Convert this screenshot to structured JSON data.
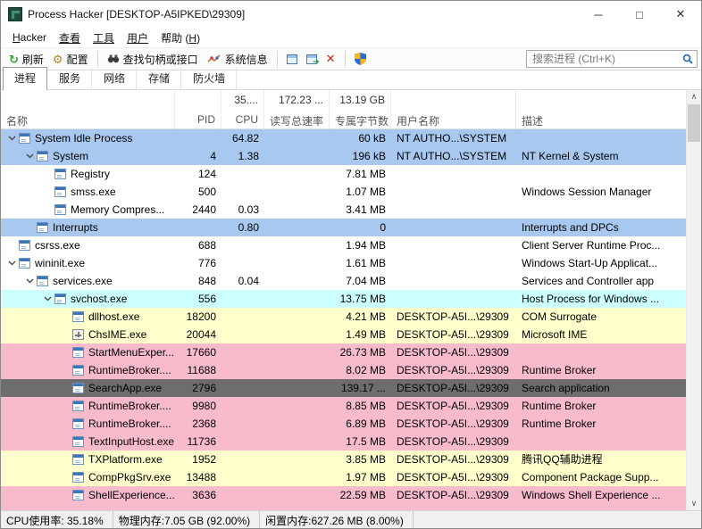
{
  "window": {
    "title": "Process Hacker [DESKTOP-A5IPKED\\29309]"
  },
  "window_controls": {
    "minimize": "─",
    "maximize": "□",
    "close": "✕"
  },
  "menu": {
    "hacker_accel": "H",
    "hacker_rest": "acker",
    "view": "查看",
    "tools": "工具",
    "users": "用户",
    "help_pre": "帮助 (",
    "help_accel": "H",
    "help_post": ")"
  },
  "toolbar": {
    "refresh": "刷新",
    "options": "配置",
    "find_handles": "查找句柄或接口",
    "system_info": "系统信息",
    "search_placeholder": "搜索进程 (Ctrl+K)"
  },
  "tabs": {
    "processes": "进程",
    "services": "服务",
    "network": "网络",
    "disk": "存储",
    "firewall": "防火墙"
  },
  "columns": {
    "name": "名称",
    "pid": "PID",
    "cpu": "CPU",
    "io": "读写总速率",
    "private": "专属字节数",
    "user": "用户名称",
    "desc": "描述",
    "totals": {
      "cpu": "35....",
      "io": "172.23 ...",
      "private": "13.19 GB"
    }
  },
  "colors": {
    "system": "#a9c8ef",
    "service": "#ccffff",
    "own": "#ffffcc",
    "immersive": "#f8bbcc",
    "suspended": "#6d6d6d",
    "none": ""
  },
  "rows": [
    {
      "name": "System Idle Process",
      "pid": "",
      "cpu": "64.82",
      "io": "",
      "priv": "60 kB",
      "user": "NT AUTHO...\\SYSTEM",
      "desc": "",
      "color": "system",
      "level": 0,
      "expanded": true
    },
    {
      "name": "System",
      "pid": "4",
      "cpu": "1.38",
      "io": "",
      "priv": "196 kB",
      "user": "NT AUTHO...\\SYSTEM",
      "desc": "NT Kernel & System",
      "color": "system",
      "level": 1,
      "expanded": true
    },
    {
      "name": "Registry",
      "pid": "124",
      "cpu": "",
      "io": "",
      "priv": "7.81 MB",
      "user": "",
      "desc": "",
      "color": "none",
      "level": 2,
      "expanded": false
    },
    {
      "name": "smss.exe",
      "pid": "500",
      "cpu": "",
      "io": "",
      "priv": "1.07 MB",
      "user": "",
      "desc": "Windows Session Manager",
      "color": "none",
      "level": 2,
      "expanded": false
    },
    {
      "name": "Memory Compres...",
      "pid": "2440",
      "cpu": "0.03",
      "io": "",
      "priv": "3.41 MB",
      "user": "",
      "desc": "",
      "color": "none",
      "level": 2,
      "expanded": false
    },
    {
      "name": "Interrupts",
      "pid": "",
      "cpu": "0.80",
      "io": "",
      "priv": "0",
      "user": "",
      "desc": "Interrupts and DPCs",
      "color": "system",
      "level": 1,
      "expanded": false
    },
    {
      "name": "csrss.exe",
      "pid": "688",
      "cpu": "",
      "io": "",
      "priv": "1.94 MB",
      "user": "",
      "desc": "Client Server Runtime Proc...",
      "color": "none",
      "level": 0,
      "expanded": false
    },
    {
      "name": "wininit.exe",
      "pid": "776",
      "cpu": "",
      "io": "",
      "priv": "1.61 MB",
      "user": "",
      "desc": "Windows Start-Up Applicat...",
      "color": "none",
      "level": 0,
      "expanded": true
    },
    {
      "name": "services.exe",
      "pid": "848",
      "cpu": "0.04",
      "io": "",
      "priv": "7.04 MB",
      "user": "",
      "desc": "Services and Controller app",
      "color": "none",
      "level": 1,
      "expanded": true
    },
    {
      "name": "svchost.exe",
      "pid": "556",
      "cpu": "",
      "io": "",
      "priv": "13.75 MB",
      "user": "",
      "desc": "Host Process for Windows ...",
      "color": "service",
      "level": 2,
      "expanded": true
    },
    {
      "name": "dllhost.exe",
      "pid": "18200",
      "cpu": "",
      "io": "",
      "priv": "4.21 MB",
      "user": "DESKTOP-A5I...\\29309",
      "desc": "COM Surrogate",
      "color": "own",
      "level": 3,
      "expanded": false
    },
    {
      "name": "ChsIME.exe",
      "pid": "20044",
      "cpu": "",
      "io": "",
      "priv": "1.49 MB",
      "user": "DESKTOP-A5I...\\29309",
      "desc": "Microsoft IME",
      "color": "own",
      "level": 3,
      "expanded": false,
      "icon": "ime"
    },
    {
      "name": "StartMenuExper...",
      "pid": "17660",
      "cpu": "",
      "io": "",
      "priv": "26.73 MB",
      "user": "DESKTOP-A5I...\\29309",
      "desc": "",
      "color": "immersive",
      "level": 3,
      "expanded": false
    },
    {
      "name": "RuntimeBroker....",
      "pid": "11688",
      "cpu": "",
      "io": "",
      "priv": "8.02 MB",
      "user": "DESKTOP-A5I...\\29309",
      "desc": "Runtime Broker",
      "color": "immersive",
      "level": 3,
      "expanded": false
    },
    {
      "name": "SearchApp.exe",
      "pid": "2796",
      "cpu": "",
      "io": "",
      "priv": "139.17 ...",
      "user": "DESKTOP-A5I...\\29309",
      "desc": "Search application",
      "color": "suspended",
      "level": 3,
      "expanded": false
    },
    {
      "name": "RuntimeBroker....",
      "pid": "9980",
      "cpu": "",
      "io": "",
      "priv": "8.85 MB",
      "user": "DESKTOP-A5I...\\29309",
      "desc": "Runtime Broker",
      "color": "immersive",
      "level": 3,
      "expanded": false
    },
    {
      "name": "RuntimeBroker....",
      "pid": "2368",
      "cpu": "",
      "io": "",
      "priv": "6.89 MB",
      "user": "DESKTOP-A5I...\\29309",
      "desc": "Runtime Broker",
      "color": "immersive",
      "level": 3,
      "expanded": false
    },
    {
      "name": "TextInputHost.exe",
      "pid": "11736",
      "cpu": "",
      "io": "",
      "priv": "17.5 MB",
      "user": "DESKTOP-A5I...\\29309",
      "desc": "",
      "color": "immersive",
      "level": 3,
      "expanded": false
    },
    {
      "name": "TXPlatform.exe",
      "pid": "1952",
      "cpu": "",
      "io": "",
      "priv": "3.85 MB",
      "user": "DESKTOP-A5I...\\29309",
      "desc": "腾讯QQ辅助进程",
      "color": "own",
      "level": 3,
      "expanded": false
    },
    {
      "name": "CompPkgSrv.exe",
      "pid": "13488",
      "cpu": "",
      "io": "",
      "priv": "1.97 MB",
      "user": "DESKTOP-A5I...\\29309",
      "desc": "Component Package Supp...",
      "color": "own",
      "level": 3,
      "expanded": false
    },
    {
      "name": "ShellExperience...",
      "pid": "3636",
      "cpu": "",
      "io": "",
      "priv": "22.59 MB",
      "user": "DESKTOP-A5I...\\29309",
      "desc": "Windows Shell Experience ...",
      "color": "immersive",
      "level": 3,
      "expanded": false
    },
    {
      "name": "",
      "pid": "",
      "cpu": "",
      "io": "",
      "priv": "",
      "user": "",
      "desc": "",
      "color": "immersive",
      "level": 3,
      "expanded": false,
      "partial": true
    }
  ],
  "statusbar": {
    "cpu": "CPU使用率: 35.18%",
    "physical": "物理内存:7.05 GB (92.00%)",
    "free": "闲置内存:627.26 MB (8.00%)"
  },
  "scrollbar": {
    "up": "∧",
    "down": "∨"
  }
}
